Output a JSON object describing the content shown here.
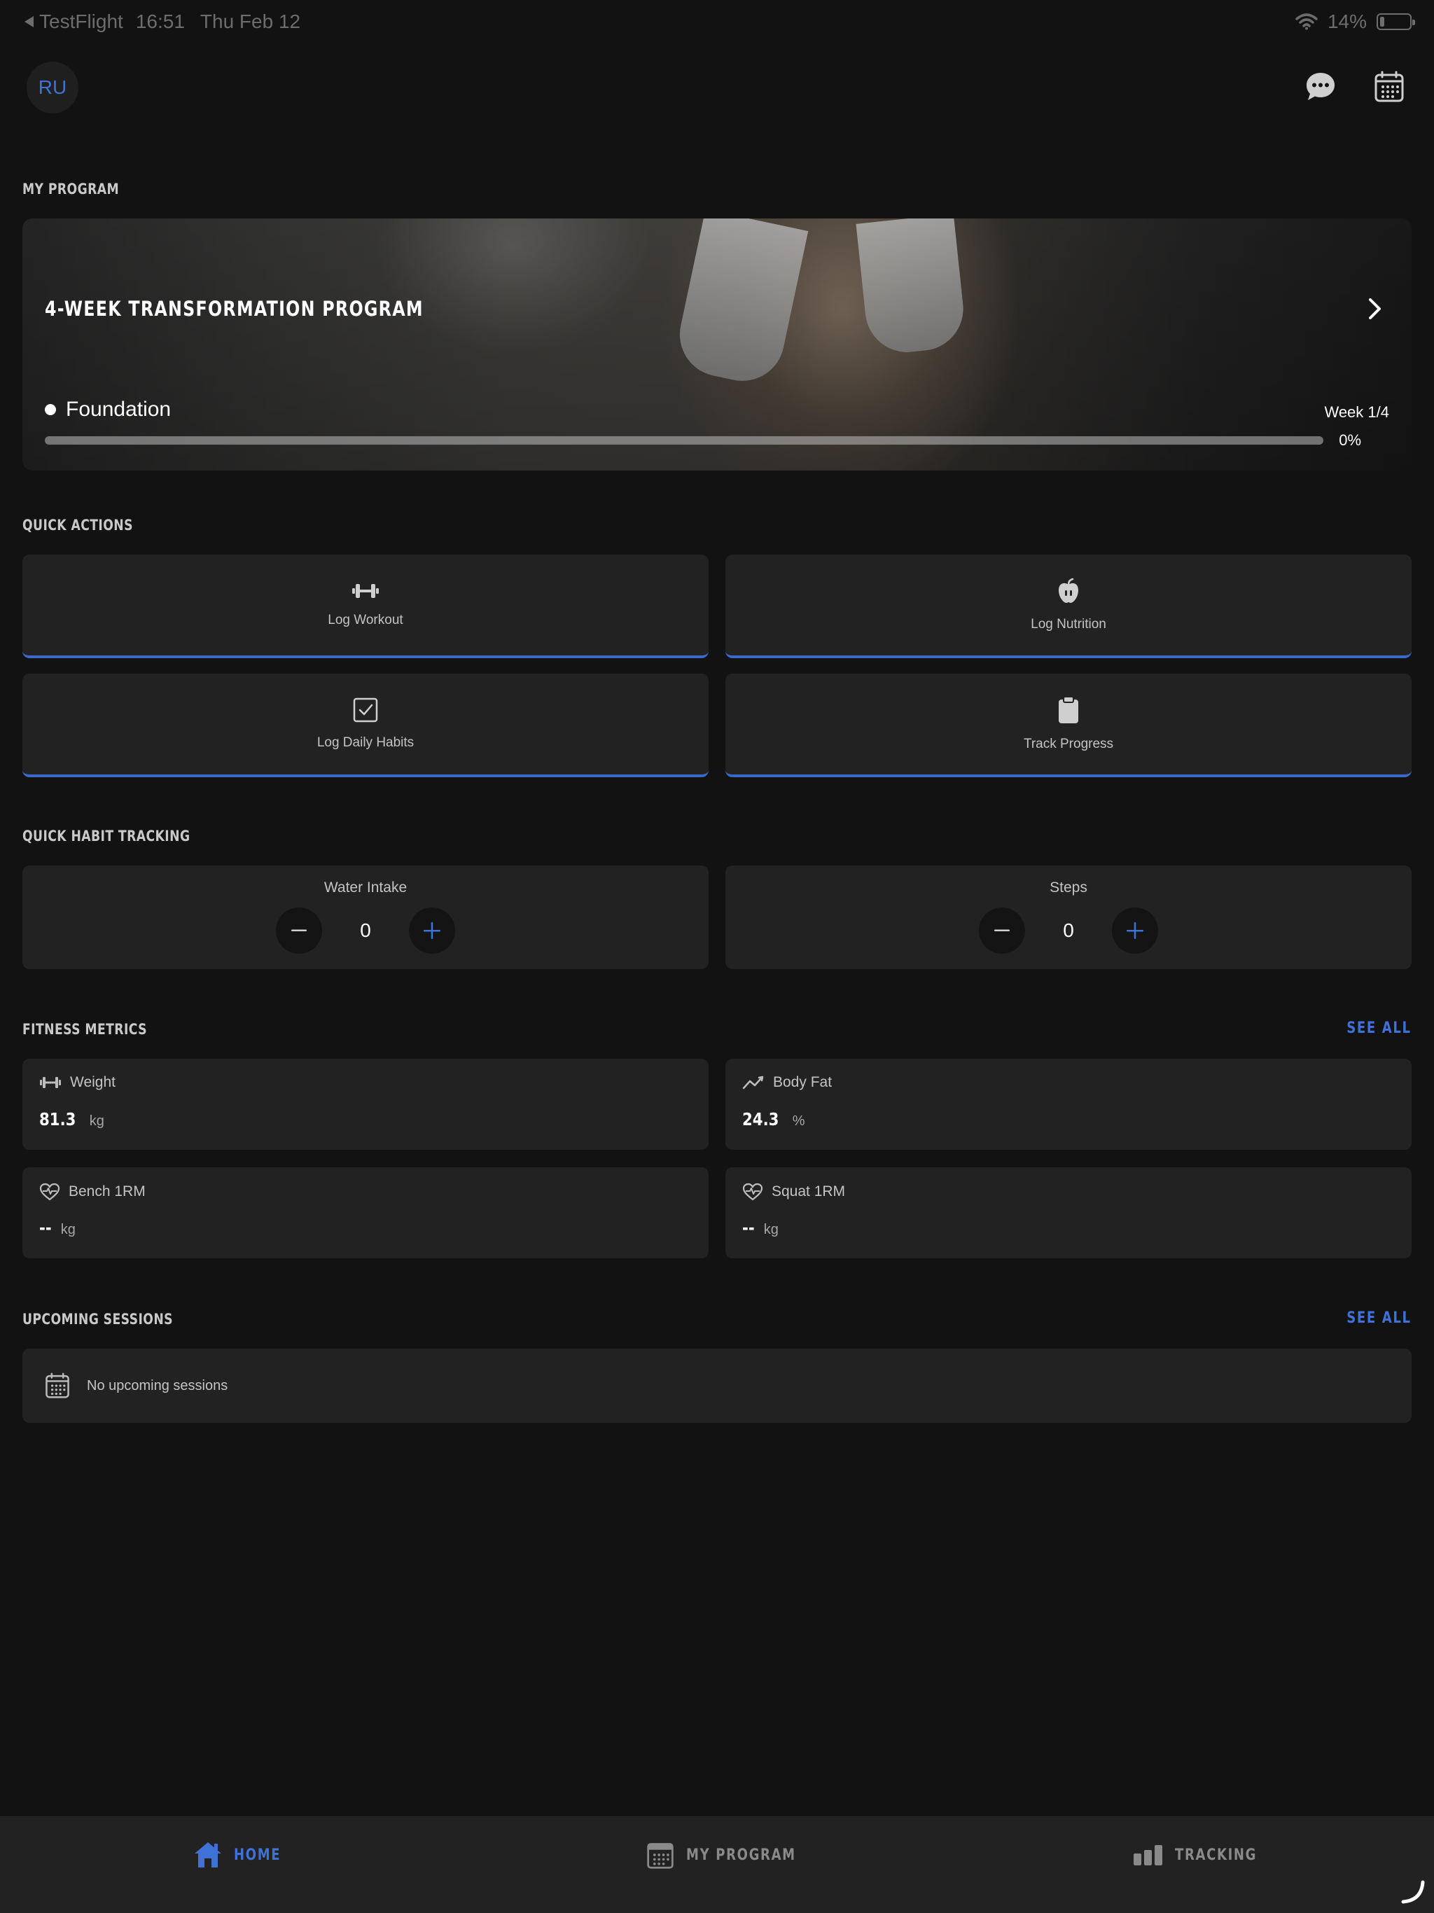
{
  "status_bar": {
    "back_app": "TestFlight",
    "time": "16:51",
    "date": "Thu Feb 12",
    "battery_pct": "14%"
  },
  "header": {
    "avatar_initials": "RU"
  },
  "sections": {
    "my_program": "MY PROGRAM",
    "quick_actions": "QUICK ACTIONS",
    "quick_habit_tracking": "QUICK HABIT TRACKING",
    "fitness_metrics": "FITNESS METRICS",
    "upcoming_sessions": "UPCOMING SESSIONS",
    "see_all": "SEE ALL"
  },
  "program": {
    "title": "4-WEEK TRANSFORMATION PROGRAM",
    "phase": "Foundation",
    "week": "Week 1/4",
    "progress_label": "0%",
    "progress_value": 0
  },
  "quick_actions": [
    {
      "label": "Log Workout",
      "icon": "dumbbell-icon"
    },
    {
      "label": "Log Nutrition",
      "icon": "apple-icon"
    },
    {
      "label": "Log Daily Habits",
      "icon": "checkbox-icon"
    },
    {
      "label": "Track Progress",
      "icon": "clipboard-icon"
    }
  ],
  "habits": [
    {
      "title": "Water Intake",
      "value": "0"
    },
    {
      "title": "Steps",
      "value": "0"
    }
  ],
  "metrics": [
    {
      "label": "Weight",
      "value": "81.3",
      "unit": "kg",
      "icon": "dumbbell-icon"
    },
    {
      "label": "Body Fat",
      "value": "24.3",
      "unit": "%",
      "icon": "trend-line-icon"
    },
    {
      "label": "Bench 1RM",
      "value": "--",
      "unit": "kg",
      "icon": "heart-pulse-icon"
    },
    {
      "label": "Squat 1RM",
      "value": "--",
      "unit": "kg",
      "icon": "heart-pulse-icon"
    }
  ],
  "sessions": {
    "empty_text": "No upcoming sessions"
  },
  "nav": [
    {
      "label": "HOME",
      "icon": "home-icon",
      "active": true
    },
    {
      "label": "MY PROGRAM",
      "icon": "calendar-icon",
      "active": false
    },
    {
      "label": "TRACKING",
      "icon": "bar-chart-icon",
      "active": false
    }
  ],
  "colors": {
    "accent": "#3f72d6",
    "background": "#121212",
    "card": "#222222"
  }
}
